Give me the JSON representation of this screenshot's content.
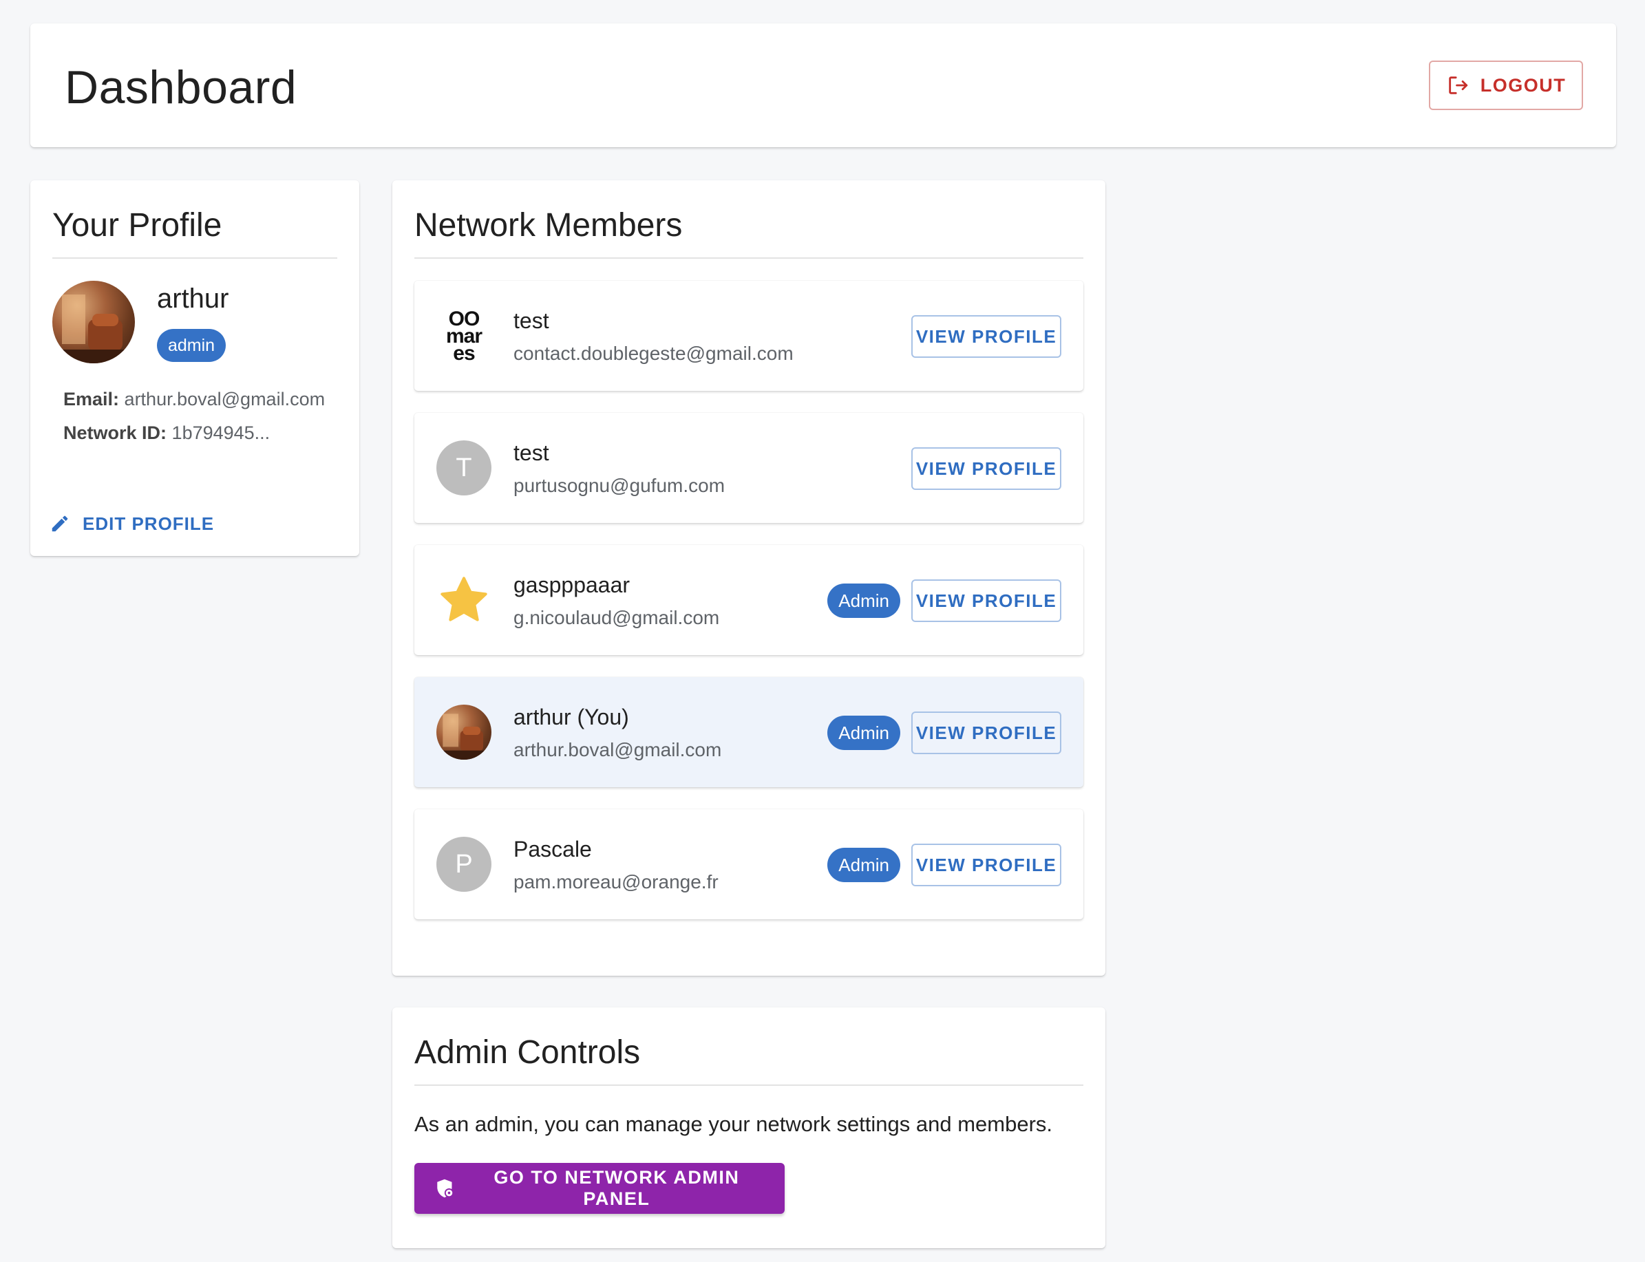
{
  "header": {
    "title": "Dashboard",
    "logout_label": "LOGOUT"
  },
  "profile": {
    "title": "Your Profile",
    "name": "arthur",
    "role": "admin",
    "email_label": "Email:",
    "email": "arthur.boval@gmail.com",
    "network_id_label": "Network ID:",
    "network_id": "1b794945...",
    "edit_label": "EDIT PROFILE"
  },
  "members": {
    "title": "Network Members",
    "view_label": "VIEW PROFILE",
    "items": [
      {
        "name": "test",
        "email": "contact.doublegeste@gmail.com",
        "avatar": "logo",
        "logo_lines": [
          "OO",
          "mar",
          "es"
        ],
        "badge": ""
      },
      {
        "name": "test",
        "email": "purtusognu@gufum.com",
        "avatar": "letter",
        "initial": "T",
        "badge": ""
      },
      {
        "name": "gaspppaaar",
        "email": "g.nicoulaud@gmail.com",
        "avatar": "star",
        "badge": "Admin"
      },
      {
        "name": "arthur (You)",
        "email": "arthur.boval@gmail.com",
        "avatar": "photo",
        "badge": "Admin"
      },
      {
        "name": "Pascale",
        "email": "pam.moreau@orange.fr",
        "avatar": "letter",
        "initial": "P",
        "badge": "Admin"
      }
    ]
  },
  "admin": {
    "title": "Admin Controls",
    "description": "As an admin, you can manage your network settings and members.",
    "button_label": "GO TO NETWORK ADMIN PANEL"
  },
  "colors": {
    "primary": "#3572c6",
    "danger": "#c62f2a",
    "admin_button": "#8e24aa",
    "self_row": "#eef3fb",
    "star": "#f6c343"
  },
  "icons": {
    "logout": "logout-icon",
    "edit": "pencil-icon",
    "admin_panel": "shield-gear-icon",
    "star_avatar": "star-icon"
  }
}
